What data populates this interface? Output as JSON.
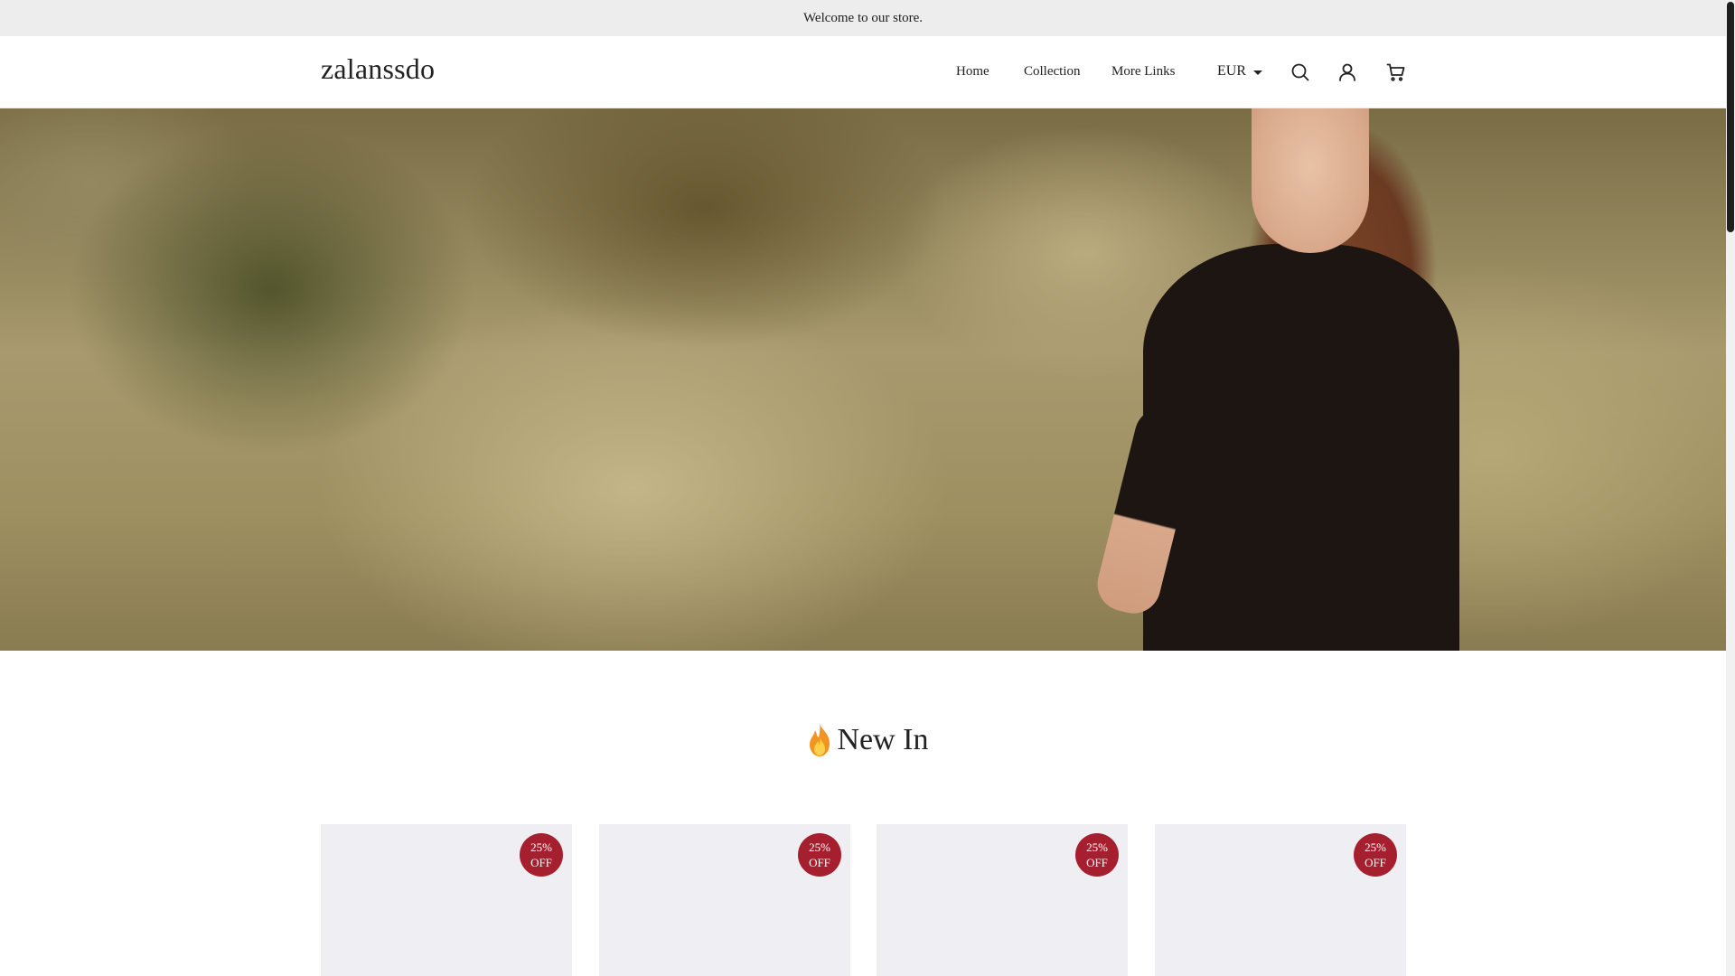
{
  "announcement": {
    "text": "Welcome to our store."
  },
  "header": {
    "logo": "zalanssdo",
    "nav": [
      {
        "label": "Home"
      },
      {
        "label": "Collection"
      },
      {
        "label": "More Links"
      }
    ],
    "currency": "EUR",
    "icons": [
      "search-icon",
      "user-icon",
      "cart-icon"
    ]
  },
  "hero": {
    "description_icon": "hero-image"
  },
  "section": {
    "title": "New In",
    "icon": "flame-icon"
  },
  "products": [
    {
      "badge_line1": "25%",
      "badge_line2": "OFF"
    },
    {
      "badge_line1": "25%",
      "badge_line2": "OFF"
    },
    {
      "badge_line1": "25%",
      "badge_line2": "OFF"
    },
    {
      "badge_line1": "25%",
      "badge_line2": "OFF"
    }
  ],
  "colors": {
    "announcement_bg": "#ededed",
    "badge": "#a51f2e",
    "card_bg": "#efeef3",
    "text": "#222222"
  }
}
